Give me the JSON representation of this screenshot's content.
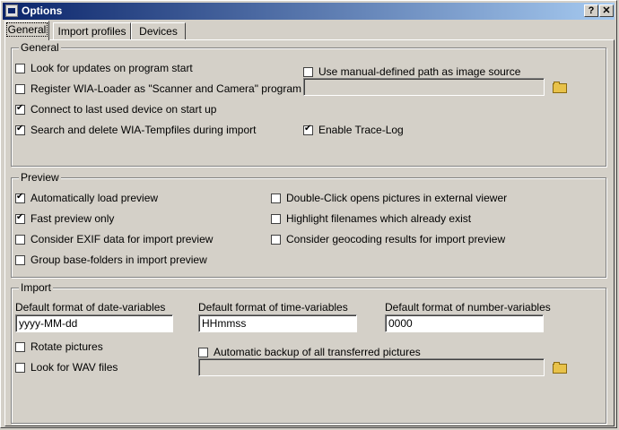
{
  "window": {
    "title": "Options"
  },
  "tabs": [
    {
      "label": "General"
    },
    {
      "label": "Import profiles"
    },
    {
      "label": "Devices"
    }
  ],
  "general": {
    "legend": "General",
    "look_updates": "Look for updates on program start",
    "register_wia": "Register WIA-Loader  as  \"Scanner and Camera\" program",
    "connect_last": "Connect to last used device on start up",
    "search_delete": "Search and delete WIA-Tempfiles during import",
    "manual_path": "Use manual-defined path as image source",
    "manual_path_value": "",
    "trace_log": "Enable Trace-Log"
  },
  "preview": {
    "legend": "Preview",
    "auto_load": "Automatically load preview",
    "fast_preview": "Fast preview only",
    "exif": "Consider EXIF data for import preview",
    "group_base": "Group base-folders in import preview",
    "double_click": "Double-Click opens pictures in external viewer",
    "highlight": "Highlight filenames which already exist",
    "geocoding": "Consider geocoding results for import preview"
  },
  "import": {
    "legend": "Import",
    "date_label": "Default format of date-variables",
    "date_value": "yyyy-MM-dd",
    "time_label": "Default format of time-variables",
    "time_value": "HHmmss",
    "number_label": "Default format of number-variables",
    "number_value": "0000",
    "rotate": "Rotate pictures",
    "wav": "Look for WAV files",
    "backup": "Automatic backup of all transferred pictures",
    "backup_value": ""
  }
}
